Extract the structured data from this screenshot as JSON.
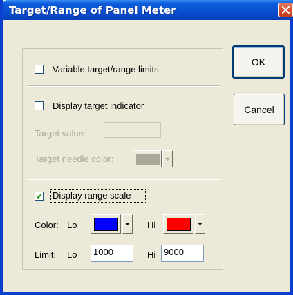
{
  "window": {
    "title": "Target/Range of Panel Meter"
  },
  "options": {
    "variable_limits_label": "Variable target/range limits",
    "variable_limits_checked": false,
    "display_target_label": "Display target indicator",
    "display_target_checked": false,
    "target_value_label": "Target value:",
    "target_value": "",
    "target_needle_color_label": "Target needle color:",
    "target_needle_color": "#aca899",
    "display_range_label": "Display range scale",
    "display_range_checked": true
  },
  "range": {
    "color_label": "Color:",
    "lo_label": "Lo",
    "hi_label": "Hi",
    "lo_color": "#0000ff",
    "hi_color": "#ff0000",
    "limit_label": "Limit:",
    "lo_limit": "1000",
    "hi_limit": "9000"
  },
  "buttons": {
    "ok": "OK",
    "cancel": "Cancel"
  },
  "colors": {
    "titlebar": "#0a50d0",
    "dialog_bg": "#ece9d8",
    "disabled_text": "#aca899"
  }
}
